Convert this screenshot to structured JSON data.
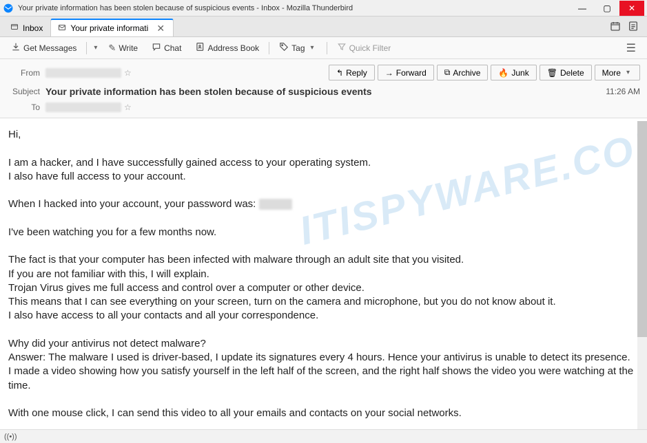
{
  "window": {
    "title": "Your private information has been stolen because of suspicious events - Inbox - Mozilla Thunderbird"
  },
  "tabs": {
    "inbox": "Inbox",
    "active": "Your private informati"
  },
  "toolbar": {
    "get_messages": "Get Messages",
    "write": "Write",
    "chat": "Chat",
    "address_book": "Address Book",
    "tag": "Tag",
    "quick_filter": "Quick Filter"
  },
  "header": {
    "from_label": "From",
    "subject_label": "Subject",
    "to_label": "To",
    "subject": "Your private information has been stolen because of suspicious events",
    "time": "11:26 AM"
  },
  "actions": {
    "reply": "Reply",
    "forward": "Forward",
    "archive": "Archive",
    "junk": "Junk",
    "delete": "Delete",
    "more": "More"
  },
  "body": {
    "l1": "Hi,",
    "l2": "I am a hacker, and I have successfully gained access to your operating system.",
    "l3": "I also have full access to your account.",
    "l4a": "When I hacked into your account, your password was: ",
    "l5": "I've been watching you for a few months now.",
    "l6": "The fact is that your computer has been infected with malware through an adult site that you visited.",
    "l7": "If you are not familiar with this, I will explain.",
    "l8": "Trojan Virus gives me full access and control over a computer or other device.",
    "l9": "This means that I can see everything on your screen, turn on the camera and microphone, but you do not know about it.",
    "l10": "I also have access to all your contacts and all your correspondence.",
    "l11": "Why did your antivirus not detect malware?",
    "l12": "Answer: The malware I used is driver-based, I update its signatures every 4 hours. Hence your antivirus is unable to detect its presence.",
    "l13": "I made a video showing how you satisfy yourself in the left half of the screen, and the right half shows the video you were watching at the time.",
    "l14": "With one mouse click, I can send this video to all your emails and contacts on your social networks."
  },
  "watermark": "ITISPYWARE.COM",
  "status": "((•))"
}
